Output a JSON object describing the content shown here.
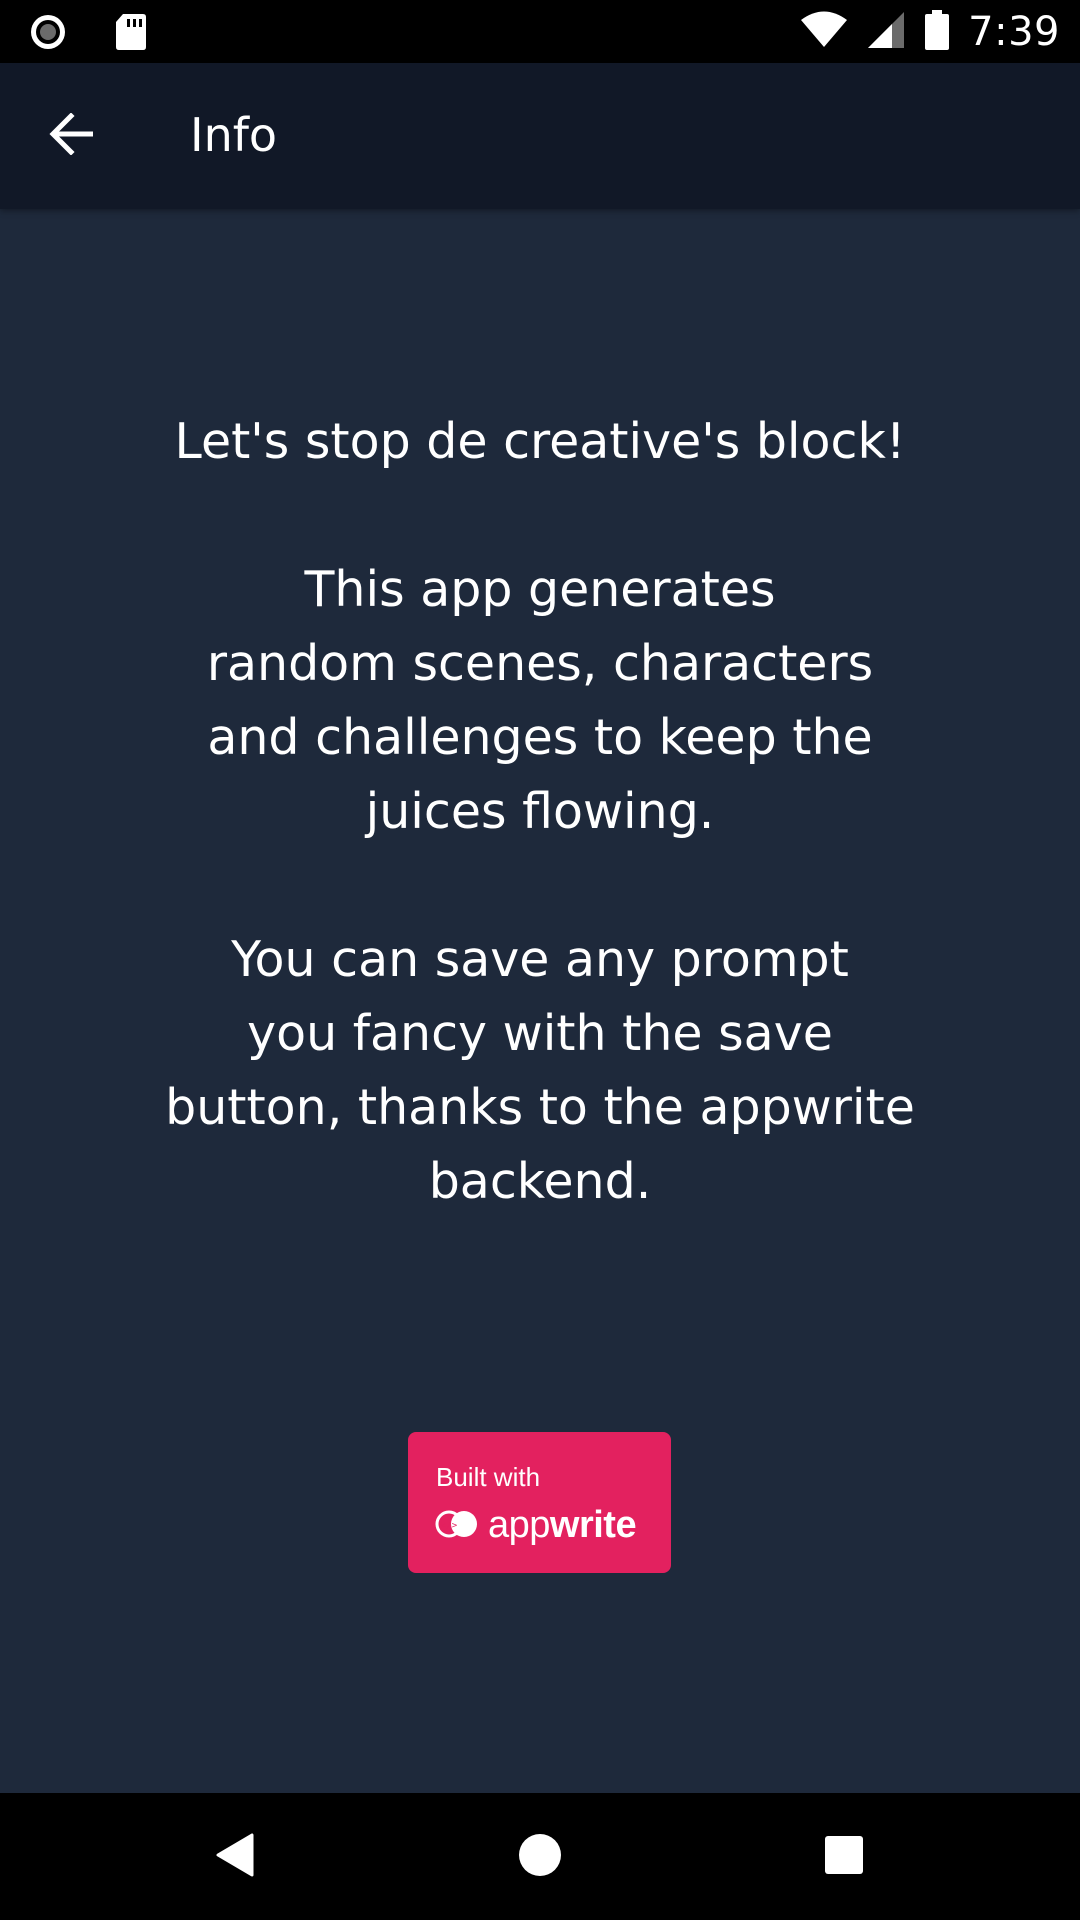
{
  "status_bar": {
    "time": "7:39",
    "icons": [
      "record-icon",
      "sd-card-icon",
      "wifi-icon",
      "cell-signal-icon",
      "battery-icon"
    ]
  },
  "app_bar": {
    "title": "Info",
    "back_icon": "arrow-back-icon"
  },
  "content": {
    "text": "Let's stop de creative's block!\n\n          This app generates\nrandom scenes, characters\nand challenges to keep the\njuices flowing.\n\n          You can save any prompt\nyou fancy with the save\nbutton, thanks to the appwrite\nbackend."
  },
  "badge": {
    "line1": "Built with",
    "brand_thin": "app",
    "brand_bold": "write",
    "color": "#e3215f"
  },
  "nav_bar": {
    "icons": [
      "back-triangle-icon",
      "home-circle-icon",
      "recents-square-icon"
    ]
  },
  "colors": {
    "background": "#1e293b",
    "app_bar": "#111827",
    "system_bars": "#000000"
  }
}
